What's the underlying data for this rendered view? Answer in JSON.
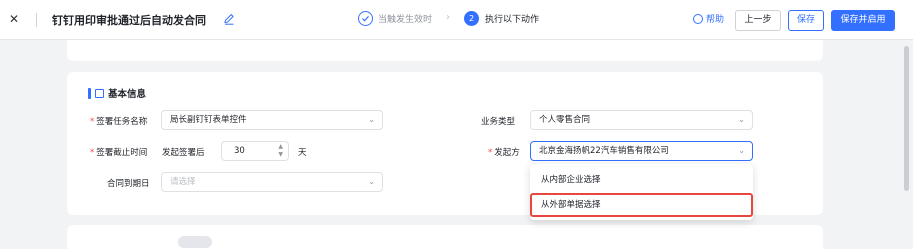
{
  "header": {
    "close_icon": "close-icon",
    "title": "钉钉用印审批通过后自动发合同",
    "edit_icon": "pencil-icon",
    "steps": [
      {
        "label": "当触发生效时",
        "icon": "check-circle-icon"
      },
      {
        "number": "2",
        "label": "执行以下动作"
      }
    ],
    "help_label": "帮助",
    "prev_label": "上一步",
    "save_label": "保存",
    "save_enable_label": "保存并启用",
    "accent_color": "#3370ff"
  },
  "section": {
    "title": "基本信息",
    "fields": {
      "task_name": {
        "label": "签署任务名称",
        "value": "局长副钉钉表单控件",
        "required": true
      },
      "business_type": {
        "label": "业务类型",
        "value": "个人零售合同",
        "required": false
      },
      "deadline": {
        "label": "签署截止时间",
        "prefix": "发起签署后",
        "value": "30",
        "unit": "天",
        "required": true
      },
      "initiator": {
        "label": "发起方",
        "value": "北京金海扬帆22汽车销售有限公司",
        "required": true
      },
      "expiry": {
        "label": "合同到期日",
        "placeholder": "请选择",
        "required": false
      }
    },
    "required_mark": "*"
  },
  "dropdown": {
    "options": [
      "从内部企业选择",
      "从外部单据选择"
    ],
    "highlight_color": "#e8473f"
  }
}
